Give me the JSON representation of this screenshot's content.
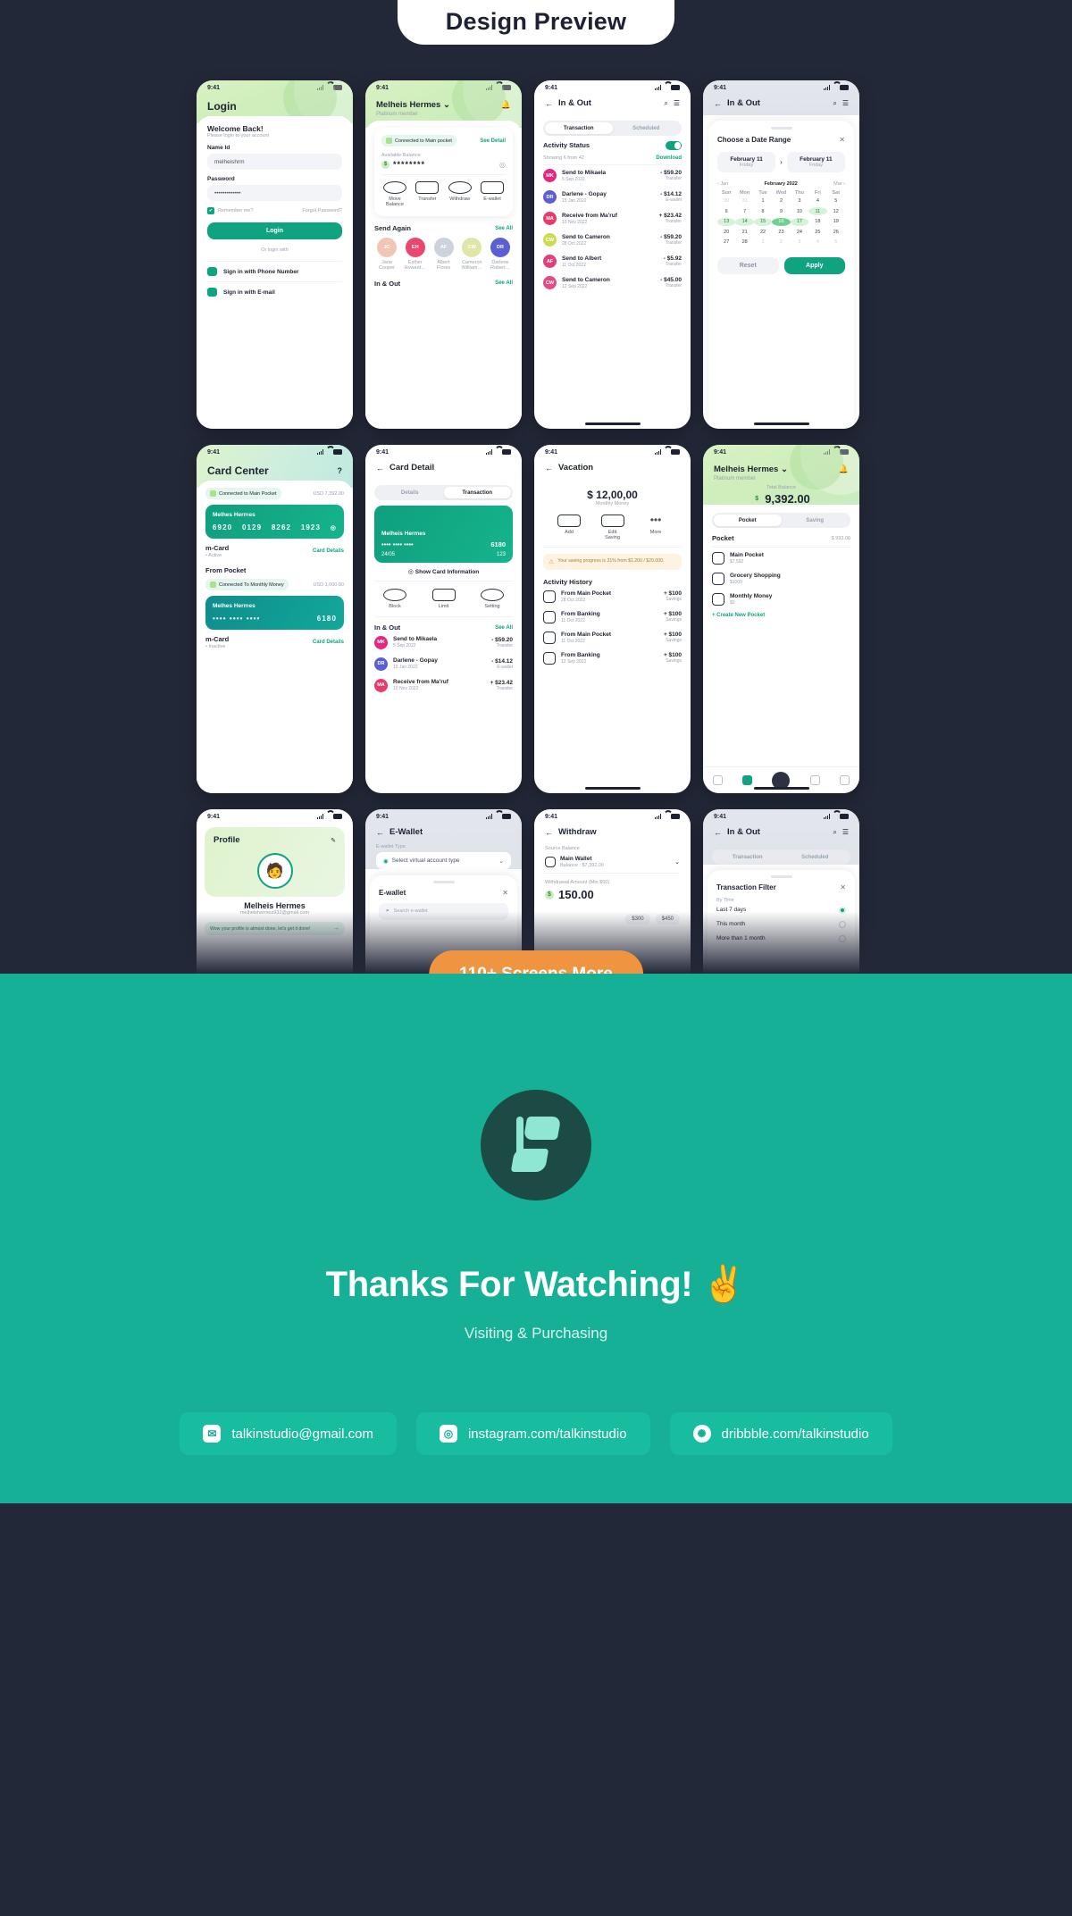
{
  "hero": {
    "title": "Design Preview"
  },
  "promo": {
    "label": "110+ Screens More"
  },
  "outro": {
    "thanks": "Thanks For Watching! ✌",
    "visiting": "Visiting & Purchasing",
    "contacts": [
      {
        "icon": "email-icon",
        "glyph": "✉",
        "label": "talkinstudio@gmail.com"
      },
      {
        "icon": "instagram-icon",
        "glyph": "◎",
        "label": "instagram.com/talkinstudio"
      },
      {
        "icon": "dribbble-icon",
        "glyph": "✺",
        "label": "dribbble.com/talkinstudio"
      }
    ]
  },
  "status_bar": {
    "time": "9:41"
  },
  "screens": {
    "login": {
      "title": "Login",
      "welcome": "Welcome Back!",
      "welcome_sub": "Please login to your account",
      "name_label": "Name Id",
      "name_value": "melheishrm",
      "password_label": "Password",
      "password_value": "•••••••••••••",
      "remember": "Remember me?",
      "forgot": "Forgot Password?",
      "login_button": "Login",
      "divider": "Or login with",
      "options": [
        {
          "icon": "phone-chat-icon",
          "label": "Sign in with Phone Number"
        },
        {
          "icon": "mail-icon",
          "label": "Sign in with E-mail"
        }
      ]
    },
    "home": {
      "user": "Melheis Hermes",
      "member": "Platinum member",
      "connected": "Connected to Main pocket",
      "see_detail": "See Detail",
      "balance_label": "Available Balance",
      "balance_value": "********",
      "quick_actions": [
        {
          "icon": "move-balance-icon",
          "label": "Move Balance"
        },
        {
          "icon": "transfer-icon",
          "label": "Transfer"
        },
        {
          "icon": "withdraw-icon",
          "label": "Withdraw"
        },
        {
          "icon": "ewallet-icon",
          "label": "E-wallet"
        }
      ],
      "send_again": "Send Again",
      "see_all": "See All",
      "contacts": [
        {
          "name": "Jane Cooper",
          "initials": "JC",
          "color": "#f0c7b4"
        },
        {
          "name": "Esther Howard…",
          "initials": "EH",
          "color": "#e9476f"
        },
        {
          "name": "Albert Flores",
          "initials": "AF",
          "color": "#cdd3dc"
        },
        {
          "name": "Cameron William…",
          "initials": "CW",
          "color": "#dfe6a8"
        },
        {
          "name": "Darlene Robert…",
          "initials": "DR",
          "color": "#5b5fd6"
        }
      ],
      "in_out": "In & Out"
    },
    "inout": {
      "title": "In & Out",
      "tabs": [
        "Transaction",
        "Scheduled"
      ],
      "active_tab": "Transaction",
      "activity_status": "Activity Status",
      "showing": "Showing 6 from 42",
      "download": "Download",
      "transactions": [
        {
          "initials": "MK",
          "color": "#e4287e",
          "name": "Send to Mikaela",
          "date": "5 Sep 2022",
          "amount": "- $59.20",
          "kind": "Transfer"
        },
        {
          "initials": "DR",
          "color": "#5b5fd6",
          "name": "Darlene - Gopay",
          "date": "15 Jan 2022",
          "amount": "- $14.12",
          "kind": "E-wallet"
        },
        {
          "initials": "MA",
          "color": "#e63c6b",
          "name": "Receive from Ma'ruf",
          "date": "10 Nov 2022",
          "amount": "+ $23.42",
          "kind": "Transfer"
        },
        {
          "initials": "CW",
          "color": "#cddb52",
          "name": "Send to Cameron",
          "date": "28 Oct 2022",
          "amount": "- $59.20",
          "kind": "Transfer"
        },
        {
          "initials": "AF",
          "color": "#e0407c",
          "name": "Send to Albert",
          "date": "11 Oct 2022",
          "amount": "- $5.92",
          "kind": "Transfer"
        },
        {
          "initials": "CW",
          "color": "#e34b84",
          "name": "Send to Cameron",
          "date": "12 Sep 2022",
          "amount": "- $45.00",
          "kind": "Transfer"
        }
      ]
    },
    "daterange": {
      "title": "In & Out",
      "sheet_title": "Choose a Date Range",
      "close_icon": "close-icon",
      "start": {
        "date": "February 11",
        "day": "Friday"
      },
      "end": {
        "date": "February 11",
        "day": "Friday"
      },
      "prev_month": "Jan",
      "current_month": "February 2022",
      "next_month": "Mar",
      "dow": [
        "Sun",
        "Mon",
        "Tue",
        "Wed",
        "Thu",
        "Fri",
        "Sat"
      ],
      "weeks": [
        [
          {
            "d": "30",
            "t": "mut"
          },
          {
            "d": "31",
            "t": "mut"
          },
          {
            "d": "1"
          },
          {
            "d": "2"
          },
          {
            "d": "3"
          },
          {
            "d": "4"
          },
          {
            "d": "5"
          }
        ],
        [
          {
            "d": "6"
          },
          {
            "d": "7"
          },
          {
            "d": "8"
          },
          {
            "d": "9"
          },
          {
            "d": "10"
          },
          {
            "d": "11",
            "t": "r1"
          },
          {
            "d": "12"
          }
        ],
        [
          {
            "d": "13",
            "t": "r1"
          },
          {
            "d": "14",
            "t": "r1"
          },
          {
            "d": "15",
            "t": "r1"
          },
          {
            "d": "16",
            "t": "sel"
          },
          {
            "d": "17",
            "t": "r1"
          },
          {
            "d": "18"
          },
          {
            "d": "19"
          }
        ],
        [
          {
            "d": "20"
          },
          {
            "d": "21"
          },
          {
            "d": "22"
          },
          {
            "d": "23"
          },
          {
            "d": "24"
          },
          {
            "d": "25"
          },
          {
            "d": "26"
          }
        ],
        [
          {
            "d": "27"
          },
          {
            "d": "28"
          },
          {
            "d": "1",
            "t": "mut"
          },
          {
            "d": "2",
            "t": "mut"
          },
          {
            "d": "3",
            "t": "mut"
          },
          {
            "d": "4",
            "t": "mut"
          },
          {
            "d": "5",
            "t": "mut"
          }
        ]
      ],
      "reset": "Reset",
      "apply": "Apply"
    },
    "cardcenter": {
      "title": "Card Center",
      "help": "?",
      "connected": "Connected to Main Pocket",
      "connected_amount": "USD 7,392.00",
      "card1": {
        "name": "Melhes Hermes",
        "num": [
          "6920",
          "0129",
          "8262",
          "1923"
        ]
      },
      "card1_label": "m-Card",
      "card1_status": "Active",
      "card_details": "Card Details",
      "from_pocket": "From Pocket",
      "connected2": "Connected To Monthly Money",
      "connected2_amount": "USD 1,000.00",
      "card2": {
        "name": "Melhes Hermes",
        "num": "6180"
      },
      "card2_label": "m-Card",
      "card2_status": "Inactive"
    },
    "carddetail": {
      "title": "Card Detail",
      "tabs": [
        "Details",
        "Transaction"
      ],
      "active_tab": "Transaction",
      "card": {
        "name": "Melheis Hermes",
        "last4": "6180",
        "exp": "24/05",
        "cvv": "123"
      },
      "show_info": "Show Card Information",
      "actions": [
        {
          "icon": "block-icon",
          "label": "Block"
        },
        {
          "icon": "limit-icon",
          "label": "Limit"
        },
        {
          "icon": "setting-icon",
          "label": "Setting"
        }
      ],
      "in_out": "In & Out",
      "see_all": "See All",
      "transactions": [
        {
          "initials": "MK",
          "color": "#e4287e",
          "name": "Send to Mikaela",
          "date": "5 Sep 2022",
          "amount": "- $59.20",
          "kind": "Transfer"
        },
        {
          "initials": "DR",
          "color": "#5b5fd6",
          "name": "Darlene - Gopay",
          "date": "15 Jan 2022",
          "amount": "- $14.12",
          "kind": "E-wallet"
        },
        {
          "initials": "MA",
          "color": "#e63c6b",
          "name": "Receive from Ma'ruf",
          "date": "10 Nov 2022",
          "amount": "+ $23.42",
          "kind": "Transfer"
        }
      ]
    },
    "vacation": {
      "title": "Vacation",
      "amount": "$ 12,00,00",
      "amount_sub": "Monthly Money",
      "actions": [
        {
          "icon": "add-icon",
          "label": "Add"
        },
        {
          "icon": "edit-saving-icon",
          "label": "Edit Saving"
        },
        {
          "icon": "more-icon",
          "label": "More"
        }
      ],
      "notice": "Your saving progress is 31% from $1.200 / $20.000.",
      "history_title": "Activity History",
      "history": [
        {
          "name": "From Main Pocket",
          "date": "28 Oct 2022",
          "amount": "+ $100",
          "kind": "Savings"
        },
        {
          "name": "From Banking",
          "date": "11 Oct 2022",
          "amount": "+ $100",
          "kind": "Savings"
        },
        {
          "name": "From Main Pocket",
          "date": "11 Oct 2022",
          "amount": "+ $100",
          "kind": "Savings"
        },
        {
          "name": "From Banking",
          "date": "12 Sep 2022",
          "amount": "+ $100",
          "kind": "Savings"
        }
      ]
    },
    "pocket": {
      "user": "Melheis Hermes",
      "member": "Platinum member",
      "total_label": "Total Balance",
      "total_value": "9,392.00",
      "tabs": [
        "Pocket",
        "Saving"
      ],
      "active_tab": "Pocket",
      "section": "Pocket",
      "section_amount": "$ 993.00",
      "items": [
        {
          "icon": "wallet-icon",
          "name": "Main Pocket",
          "amount": "$7,592"
        },
        {
          "icon": "cart-icon",
          "name": "Grocery Shopping",
          "amount": "$1000"
        },
        {
          "icon": "calendar-icon",
          "name": "Monthly Money",
          "amount": "$0"
        }
      ],
      "create": "+ Create New Pocket"
    },
    "profile": {
      "title": "Profile",
      "edit_icon": "pencil-icon",
      "name": "Melheis Hermes",
      "email": "melheishermes932@gmail.com",
      "banner": "Wow your profile is almost done, let's get it done!"
    },
    "ewallet": {
      "title": "E-Wallet",
      "type_label": "E-wallet Type",
      "select_placeholder": "Select virtual account type",
      "sheet_title": "E-wallet",
      "search_placeholder": "Search e-wallet"
    },
    "withdraw": {
      "title": "Withdraw",
      "source_label": "Source Balance",
      "source_name": "Main Wallet",
      "source_balance": "Balance : $7,392.00",
      "amount_label": "Withdrawal Amount (Min $50)",
      "amount": "150.00",
      "chips": [
        "$300",
        "$450"
      ]
    },
    "filter": {
      "title": "In & Out",
      "tabs": [
        "Transaction",
        "Scheduled"
      ],
      "sheet_title": "Transaction Filter",
      "by_time": "By Time",
      "options": [
        {
          "label": "Last 7 days",
          "selected": true
        },
        {
          "label": "This month",
          "selected": false
        },
        {
          "label": "More than 1 month",
          "selected": false
        }
      ]
    }
  }
}
